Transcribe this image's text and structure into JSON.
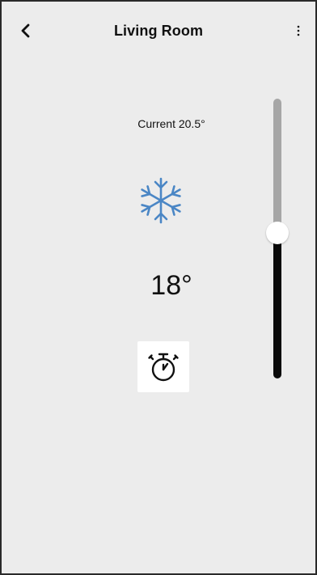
{
  "header": {
    "title": "Living Room",
    "back_icon": "chevron-left-icon",
    "more_icon": "more-vertical-icon"
  },
  "climate": {
    "current_label": "Current 20.5°",
    "mode_icon": "snowflake-icon",
    "mode_color": "#4a86c5",
    "setpoint": "18°",
    "timer_icon": "stopwatch-icon"
  },
  "slider": {
    "level": 0.52,
    "upper_color": "#a6a6a6",
    "lower_color": "#0a0a0a"
  }
}
